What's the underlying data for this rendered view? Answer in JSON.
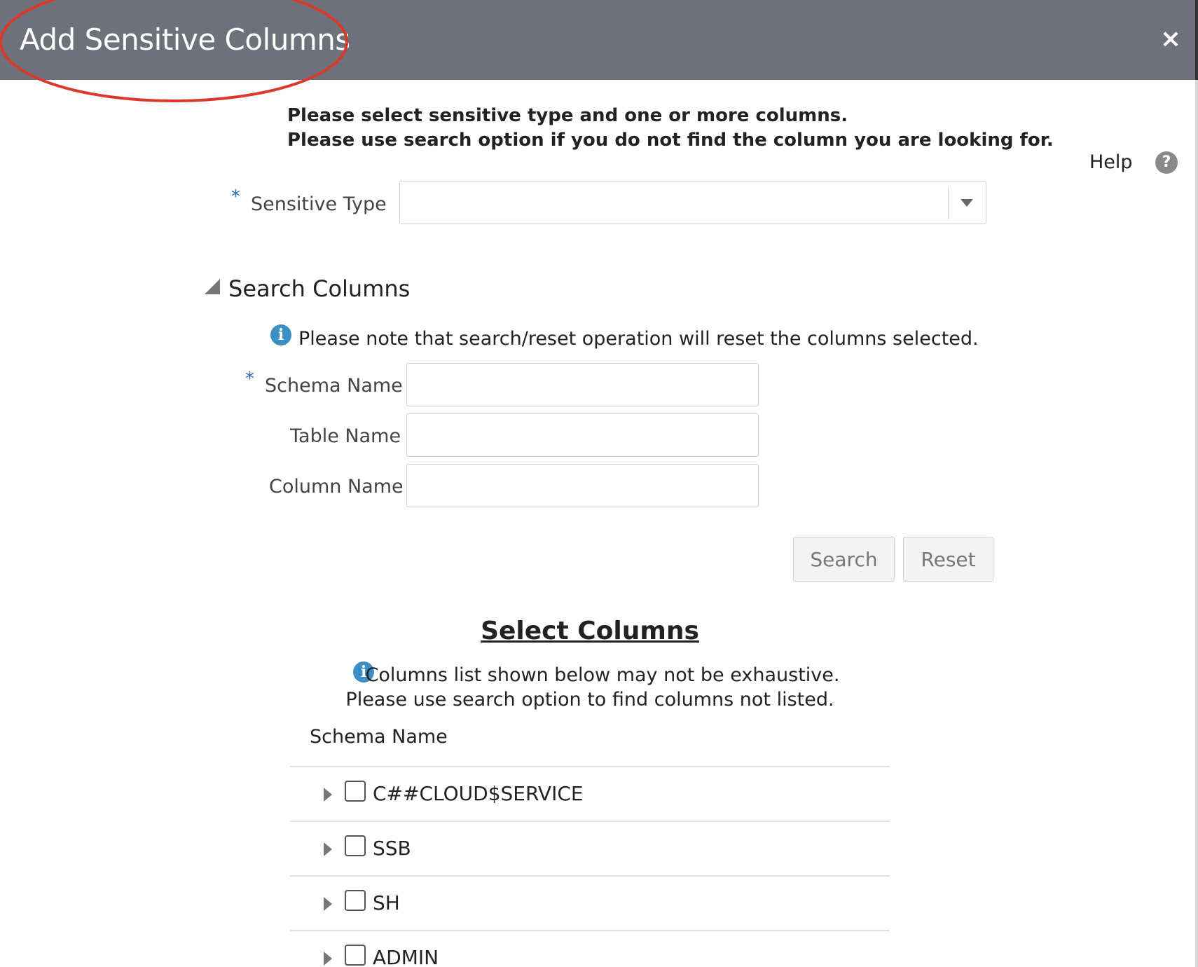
{
  "dialog": {
    "title": "Add Sensitive Columns",
    "close_label": "×"
  },
  "intro": {
    "line1": "Please select sensitive type and one or more columns.",
    "line2": "Please use search option if you do not find the column you are looking for."
  },
  "help": {
    "label": "Help",
    "icon": "question-mark-icon",
    "glyph": "?"
  },
  "sensitive_type": {
    "label": "Sensitive Type",
    "required_marker": "*",
    "value": ""
  },
  "search_section": {
    "title": "Search Columns",
    "note": "Please note that search/reset operation will reset the columns selected.",
    "fields": {
      "schema_name": {
        "label": "Schema Name",
        "required_marker": "*",
        "value": ""
      },
      "table_name": {
        "label": "Table Name",
        "value": ""
      },
      "column_name": {
        "label": "Column Name",
        "value": ""
      }
    },
    "search_button": "Search",
    "reset_button": "Reset"
  },
  "select_section": {
    "title": "Select Columns",
    "note_line1": "Columns list shown below may not be exhaustive.",
    "note_line2": "Please use search option to find columns not listed.",
    "column_header": "Schema Name",
    "rows": [
      {
        "name": "C##CLOUD$SERVICE",
        "checked": false
      },
      {
        "name": "SSB",
        "checked": false
      },
      {
        "name": "SH",
        "checked": false
      },
      {
        "name": "ADMIN",
        "checked": false
      }
    ]
  },
  "info_icon_glyph": "i",
  "colors": {
    "titlebar": "#6e7179",
    "highlight_ellipse": "#d9392b",
    "info_icon": "#3b8fc4",
    "required_marker": "#2a6ebb"
  }
}
